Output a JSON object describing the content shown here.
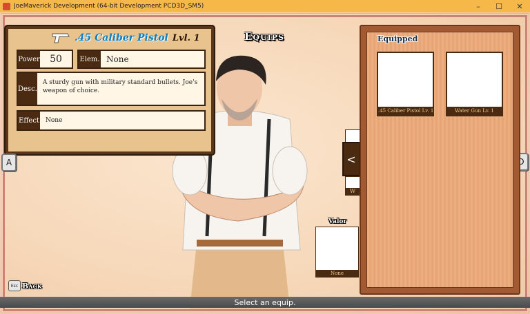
{
  "window": {
    "title": "JoeMaverick Development (64-bit Development PCD3D_SM5)",
    "buttons": [
      "–",
      "☐",
      "✕"
    ]
  },
  "screen_title": "Equips",
  "weapon": {
    "name": ".45 Caliber Pistol",
    "level": "Lvl. 1",
    "icon": "pistol-icon",
    "power_label": "Power",
    "power_value": "50",
    "element_label": "Elem.",
    "element_value": "None",
    "description_label": "Desc.",
    "description": "A sturdy gun with military standard bullets. Joe's weapon of choice.",
    "effect_label": "Effect",
    "effect_value": "None"
  },
  "nav": {
    "left_key": "A",
    "right_key": "D",
    "slot_arrow": "<",
    "partial_caption": "W"
  },
  "valor": {
    "label": "Valor",
    "slot_caption": "None"
  },
  "equipped": {
    "title": "Equipped",
    "slots": [
      {
        "caption": ".45 Caliber Pistol Lv. 1"
      },
      {
        "caption": "Water Gun Lv. 1"
      }
    ]
  },
  "back": {
    "key": "Esc",
    "label": "Back"
  },
  "hint": "Select an equip.",
  "colors": {
    "panel_border": "#5a3518",
    "weapon_name": "#0f7fbf",
    "title_bar": "#f7b84a"
  }
}
